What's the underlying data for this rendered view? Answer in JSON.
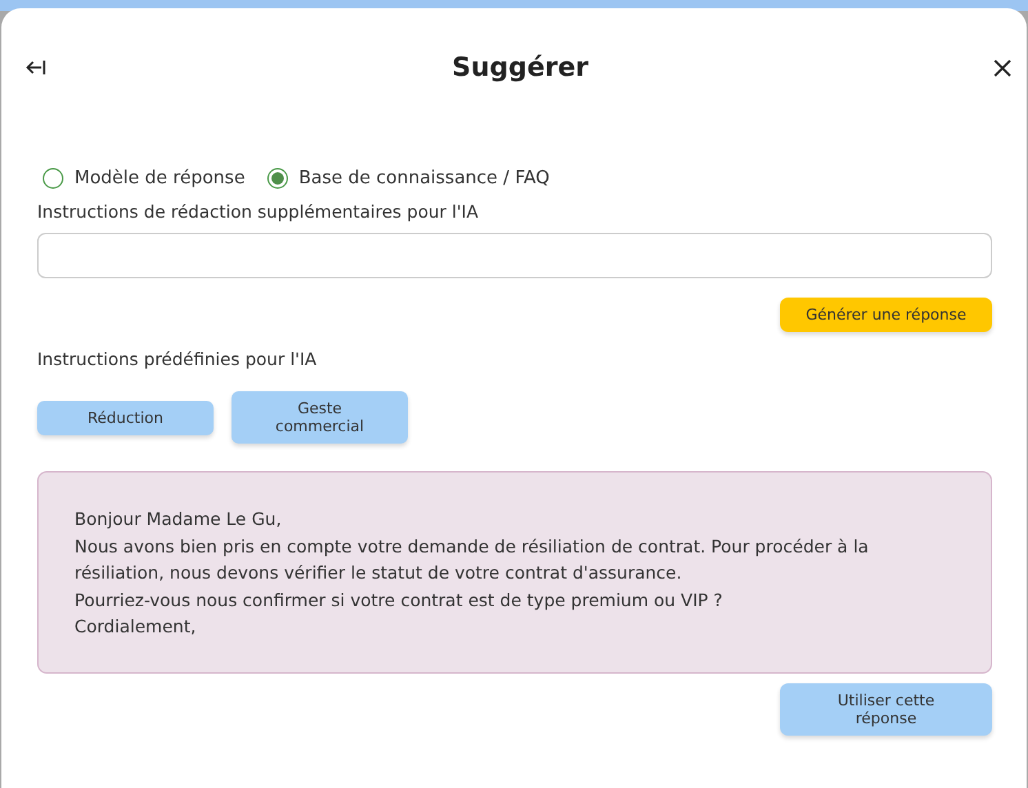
{
  "dialog": {
    "title": "Suggérer"
  },
  "source_options": [
    {
      "label": "Modèle de réponse",
      "selected": false
    },
    {
      "label": "Base de connaissance / FAQ",
      "selected": true
    }
  ],
  "instructions_field": {
    "label": "Instructions de rédaction supplémentaires pour l'IA"
  },
  "generate_button": "Générer une réponse",
  "predefined": {
    "label": "Instructions prédéfinies pour l'IA",
    "buttons": [
      "Réduction",
      "Geste commercial"
    ]
  },
  "response": {
    "text": "Bonjour Madame Le Gu,\nNous avons bien pris en compte votre demande de résiliation de contrat. Pour procéder à la résiliation, nous devons vérifier le statut de votre contrat d'assurance.\nPourriez-vous nous confirmer si votre contrat est de type premium ou VIP ?\nCordialement,"
  },
  "use_button": "Utiliser cette réponse"
}
